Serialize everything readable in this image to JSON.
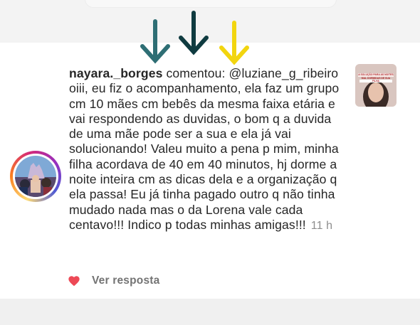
{
  "comment": {
    "username": "nayara._borges",
    "verb": "comentou:",
    "text": "@luziane_g_ribeiro oiii, eu fiz o acompanhamento, ela faz um grupo cm 10 mães cm bebês da mesma faixa etária e vai respondendo as duvidas, o bom q a duvida de uma mãe pode ser a sua e ela já vai solucionando! Valeu muito a pena p mim, minha filha acordava de 40 em 40 minutos, hj dorme a noite inteira cm as dicas dela e a organização q ela passa! Eu já tinha pagado outro q não tinha mudado nada mas o da Lorena vale cada centavo!!! Indico p todas minhas amigas!!!",
    "timestamp": "11 h",
    "reply_label": "Ver resposta"
  },
  "post_thumbnail": {
    "caption": "A SOLUÇÃO PARA AS NOITES MAL DORMIDAS DE SUA FILHA"
  },
  "colors": {
    "arrow_left": "#2e6e74",
    "arrow_middle": "#0f3b40",
    "arrow_right": "#f2d50f",
    "heart": "#ed4956",
    "timestamp": "#8e8e8e",
    "text": "#262626"
  },
  "icons": {
    "avatar": "user-avatar-photo",
    "heart": "heart-filled-icon",
    "arrows": "down-arrow-icon"
  }
}
